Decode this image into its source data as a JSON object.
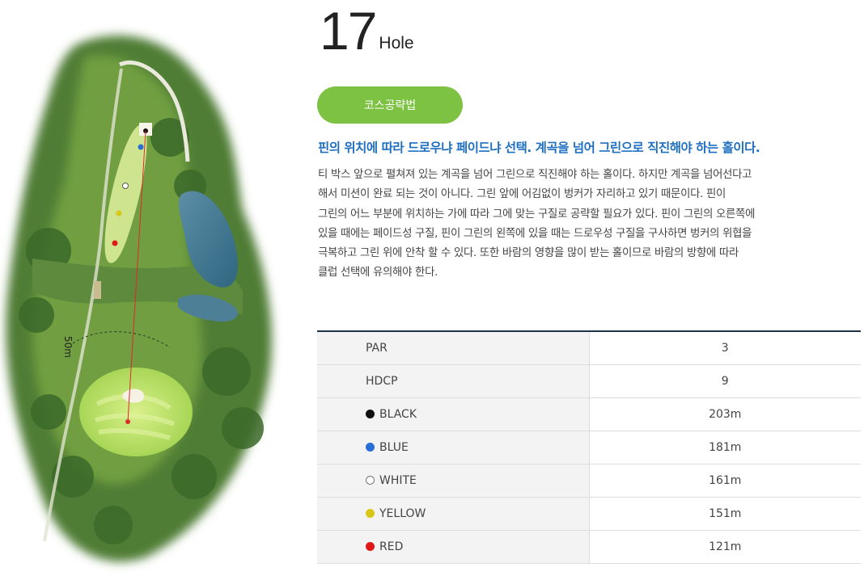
{
  "hole": {
    "number": "17",
    "word": "Hole"
  },
  "strategy_button": "코스공략법",
  "headline": "핀의 위치에 따라 드로우냐 페이드냐 선택. 계곡을 넘어 그린으로 직진해야 하는 홀이다.",
  "description_lines": [
    "티 박스 앞으로 펼쳐져 있는 계곡을 넘어 그린으로 직진해야 하는 홀이다. 하지만 계곡을 넘어선다고",
    "해서 미션이 완료 되는 것이 아니다. 그린 앞에 어김없이 벙커가 자리하고 있기 때문이다. 핀이",
    "그린의 어느 부분에 위치하는 가에 따라 그에 맞는 구질로 공략할 필요가 있다. 핀이 그린의 오른쪽에",
    "있을 때에는 페이드성 구질, 핀이 그린의 왼쪽에 있을 때는 드로우성 구질을 구사하면 벙커의 위협을",
    "극복하고 그린 위에 안착 할 수 있다. 또한 바람의 영향을 많이 받는 홀이므로 바람의 방향에 따라",
    "클럽 선택에 유의해야 한다."
  ],
  "map": {
    "distance_label": "50m"
  },
  "table": {
    "rows": [
      {
        "label": "PAR",
        "value": "3"
      },
      {
        "label": "HDCP",
        "value": "9"
      },
      {
        "label": "BLACK",
        "value": "203m",
        "dot": "#111111"
      },
      {
        "label": "BLUE",
        "value": "181m",
        "dot": "#2a6fd6"
      },
      {
        "label": "WHITE",
        "value": "161m",
        "dot": "#ffffff"
      },
      {
        "label": "YELLOW",
        "value": "151m",
        "dot": "#d8c619"
      },
      {
        "label": "RED",
        "value": "121m",
        "dot": "#e01818"
      }
    ]
  }
}
